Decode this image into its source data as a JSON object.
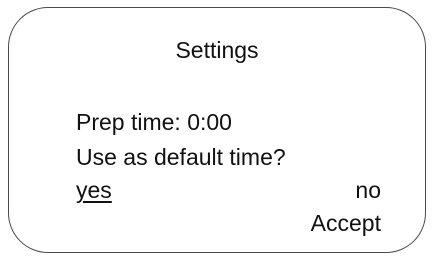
{
  "screen": {
    "title": "Settings",
    "prep_time_label": "Prep time: 0:00",
    "question": "Use as default time?",
    "options": {
      "yes": "yes",
      "no": "no"
    },
    "selected_option": "yes",
    "accept_label": "Accept"
  }
}
